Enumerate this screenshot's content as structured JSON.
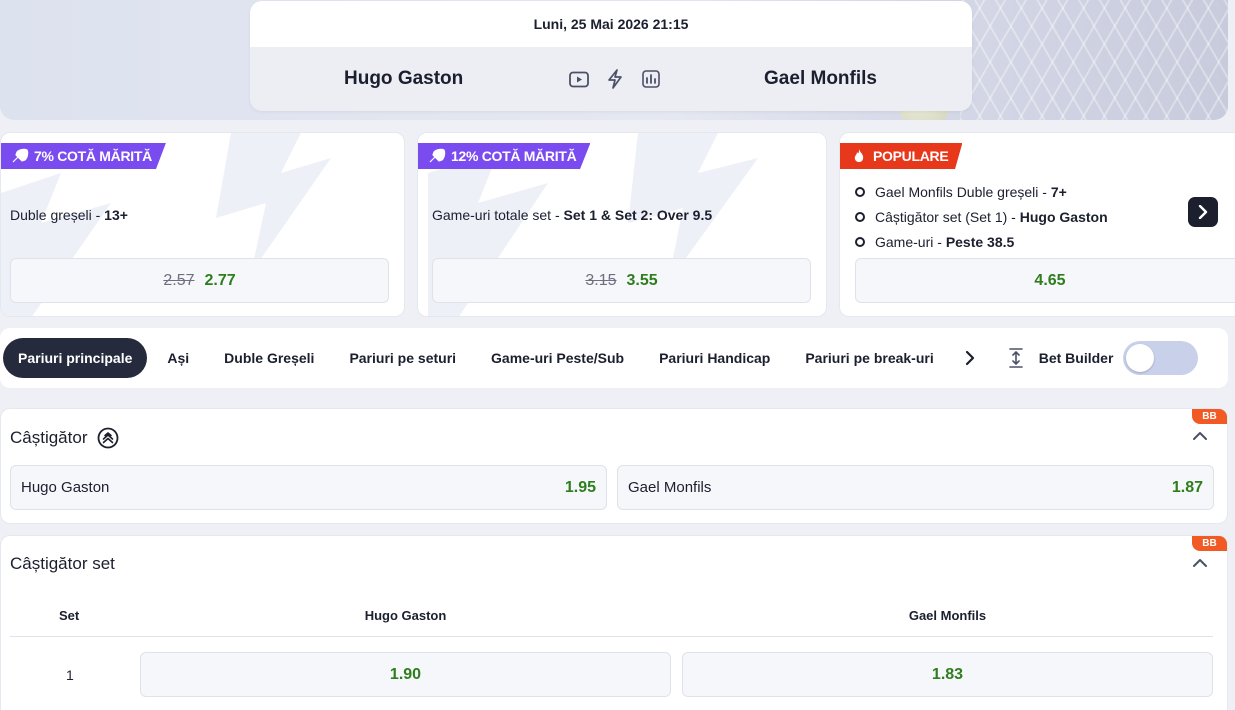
{
  "match": {
    "datetime": "Luni, 25 Mai 2026 21:15",
    "player1": "Hugo Gaston",
    "player2": "Gael Monfils",
    "icons": [
      "play-video-icon",
      "lightning-icon",
      "stats-chart-icon"
    ]
  },
  "promos": [
    {
      "badge": "7% COTĂ MĂRITĂ",
      "market": "Duble greșeli",
      "selection": "13+",
      "old_odd": "2.57",
      "new_odd": "2.77"
    },
    {
      "badge": "12% COTĂ MĂRITĂ",
      "market": "Game-uri totale set",
      "selection": "Set 1 & Set 2: Over 9.5",
      "old_odd": "3.15",
      "new_odd": "3.55"
    },
    {
      "badge": "POPULARE",
      "items": [
        {
          "market": "Gael Monfils Duble greșeli",
          "selection": "7+"
        },
        {
          "market": "Câștigător set (Set 1)",
          "selection": "Hugo Gaston"
        },
        {
          "market": "Game-uri",
          "selection": "Peste 38.5"
        }
      ],
      "odd": "4.65"
    }
  ],
  "tabs": [
    "Pariuri principale",
    "Ași",
    "Duble Greșeli",
    "Pariuri pe seturi",
    "Game-uri Peste/Sub",
    "Pariuri Handicap",
    "Pariuri pe break-uri"
  ],
  "bet_builder_label": "Bet Builder",
  "bb_tag": "BB",
  "markets": {
    "winner": {
      "title": "Câștigător",
      "options": [
        {
          "name": "Hugo Gaston",
          "odd": "1.95"
        },
        {
          "name": "Gael Monfils",
          "odd": "1.87"
        }
      ]
    },
    "set_winner": {
      "title": "Câștigător set",
      "columns": [
        "Set",
        "Hugo Gaston",
        "Gael Monfils"
      ],
      "rows": [
        {
          "set": "1",
          "p1": "1.90",
          "p2": "1.83"
        }
      ]
    }
  },
  "colors": {
    "accent_purple": "#7a4cf0",
    "accent_red": "#e8381c",
    "odd_green": "#2e7d1e",
    "dark": "#252a3d"
  }
}
